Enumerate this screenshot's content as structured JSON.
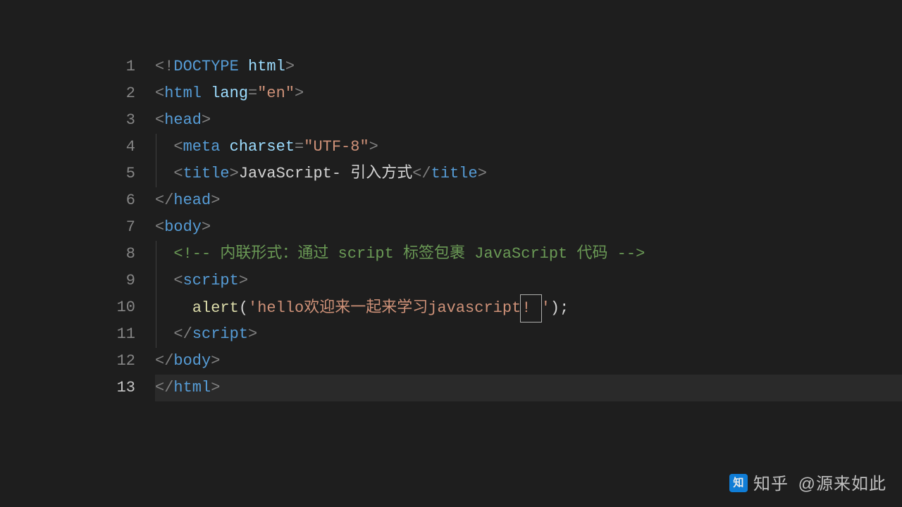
{
  "watermark": {
    "brand": "知乎",
    "author": "@源来如此"
  },
  "active_line": 13,
  "lines": [
    {
      "n": 1,
      "indent": 0,
      "guide": false,
      "tokens": [
        {
          "c": "punct",
          "t": "<!"
        },
        {
          "c": "tag",
          "t": "DOCTYPE"
        },
        {
          "c": "text",
          "t": " "
        },
        {
          "c": "attr-name",
          "t": "html"
        },
        {
          "c": "punct",
          "t": ">"
        }
      ]
    },
    {
      "n": 2,
      "indent": 0,
      "guide": false,
      "tokens": [
        {
          "c": "punct",
          "t": "<"
        },
        {
          "c": "tag",
          "t": "html"
        },
        {
          "c": "text",
          "t": " "
        },
        {
          "c": "attr-name",
          "t": "lang"
        },
        {
          "c": "punct",
          "t": "="
        },
        {
          "c": "attr-val",
          "t": "\"en\""
        },
        {
          "c": "punct",
          "t": ">"
        }
      ]
    },
    {
      "n": 3,
      "indent": 0,
      "guide": false,
      "tokens": [
        {
          "c": "punct",
          "t": "<"
        },
        {
          "c": "tag",
          "t": "head"
        },
        {
          "c": "punct",
          "t": ">"
        }
      ]
    },
    {
      "n": 4,
      "indent": 0,
      "guide": true,
      "tokens": [
        {
          "c": "text",
          "t": "  "
        },
        {
          "c": "punct",
          "t": "<"
        },
        {
          "c": "tag",
          "t": "meta"
        },
        {
          "c": "text",
          "t": " "
        },
        {
          "c": "attr-name",
          "t": "charset"
        },
        {
          "c": "punct",
          "t": "="
        },
        {
          "c": "attr-val",
          "t": "\"UTF-8\""
        },
        {
          "c": "punct",
          "t": ">"
        }
      ]
    },
    {
      "n": 5,
      "indent": 0,
      "guide": true,
      "tokens": [
        {
          "c": "text",
          "t": "  "
        },
        {
          "c": "punct",
          "t": "<"
        },
        {
          "c": "tag",
          "t": "title"
        },
        {
          "c": "punct",
          "t": ">"
        },
        {
          "c": "text",
          "t": "JavaScript- 引入方式"
        },
        {
          "c": "punct",
          "t": "</"
        },
        {
          "c": "tag",
          "t": "title"
        },
        {
          "c": "punct",
          "t": ">"
        }
      ]
    },
    {
      "n": 6,
      "indent": 0,
      "guide": false,
      "tokens": [
        {
          "c": "punct",
          "t": "</"
        },
        {
          "c": "tag",
          "t": "head"
        },
        {
          "c": "punct",
          "t": ">"
        }
      ]
    },
    {
      "n": 7,
      "indent": 0,
      "guide": false,
      "tokens": [
        {
          "c": "punct",
          "t": "<"
        },
        {
          "c": "tag",
          "t": "body"
        },
        {
          "c": "punct",
          "t": ">"
        }
      ]
    },
    {
      "n": 8,
      "indent": 0,
      "guide": true,
      "tokens": [
        {
          "c": "text",
          "t": "  "
        },
        {
          "c": "comment",
          "t": "<!-- 内联形式：通过 script 标签包裹 JavaScript 代码 -->"
        }
      ]
    },
    {
      "n": 9,
      "indent": 0,
      "guide": true,
      "tokens": [
        {
          "c": "text",
          "t": "  "
        },
        {
          "c": "punct",
          "t": "<"
        },
        {
          "c": "tag",
          "t": "script"
        },
        {
          "c": "punct",
          "t": ">"
        }
      ]
    },
    {
      "n": 10,
      "indent": 0,
      "guide": true,
      "tokens": [
        {
          "c": "text",
          "t": "    "
        },
        {
          "c": "func",
          "t": "alert"
        },
        {
          "c": "text",
          "t": "("
        },
        {
          "c": "string",
          "t": "'hello欢迎来一起来学习javascript"
        },
        {
          "c": "string cursor-box",
          "t": "! "
        },
        {
          "c": "string",
          "t": "'"
        },
        {
          "c": "text",
          "t": ");"
        }
      ]
    },
    {
      "n": 11,
      "indent": 0,
      "guide": true,
      "tokens": [
        {
          "c": "text",
          "t": "  "
        },
        {
          "c": "punct",
          "t": "</"
        },
        {
          "c": "tag",
          "t": "script"
        },
        {
          "c": "punct",
          "t": ">"
        }
      ]
    },
    {
      "n": 12,
      "indent": 0,
      "guide": false,
      "tokens": [
        {
          "c": "punct",
          "t": "</"
        },
        {
          "c": "tag",
          "t": "body"
        },
        {
          "c": "punct",
          "t": ">"
        }
      ]
    },
    {
      "n": 13,
      "indent": 0,
      "guide": false,
      "tokens": [
        {
          "c": "punct",
          "t": "</"
        },
        {
          "c": "tag",
          "t": "html"
        },
        {
          "c": "punct",
          "t": ">"
        }
      ]
    }
  ]
}
